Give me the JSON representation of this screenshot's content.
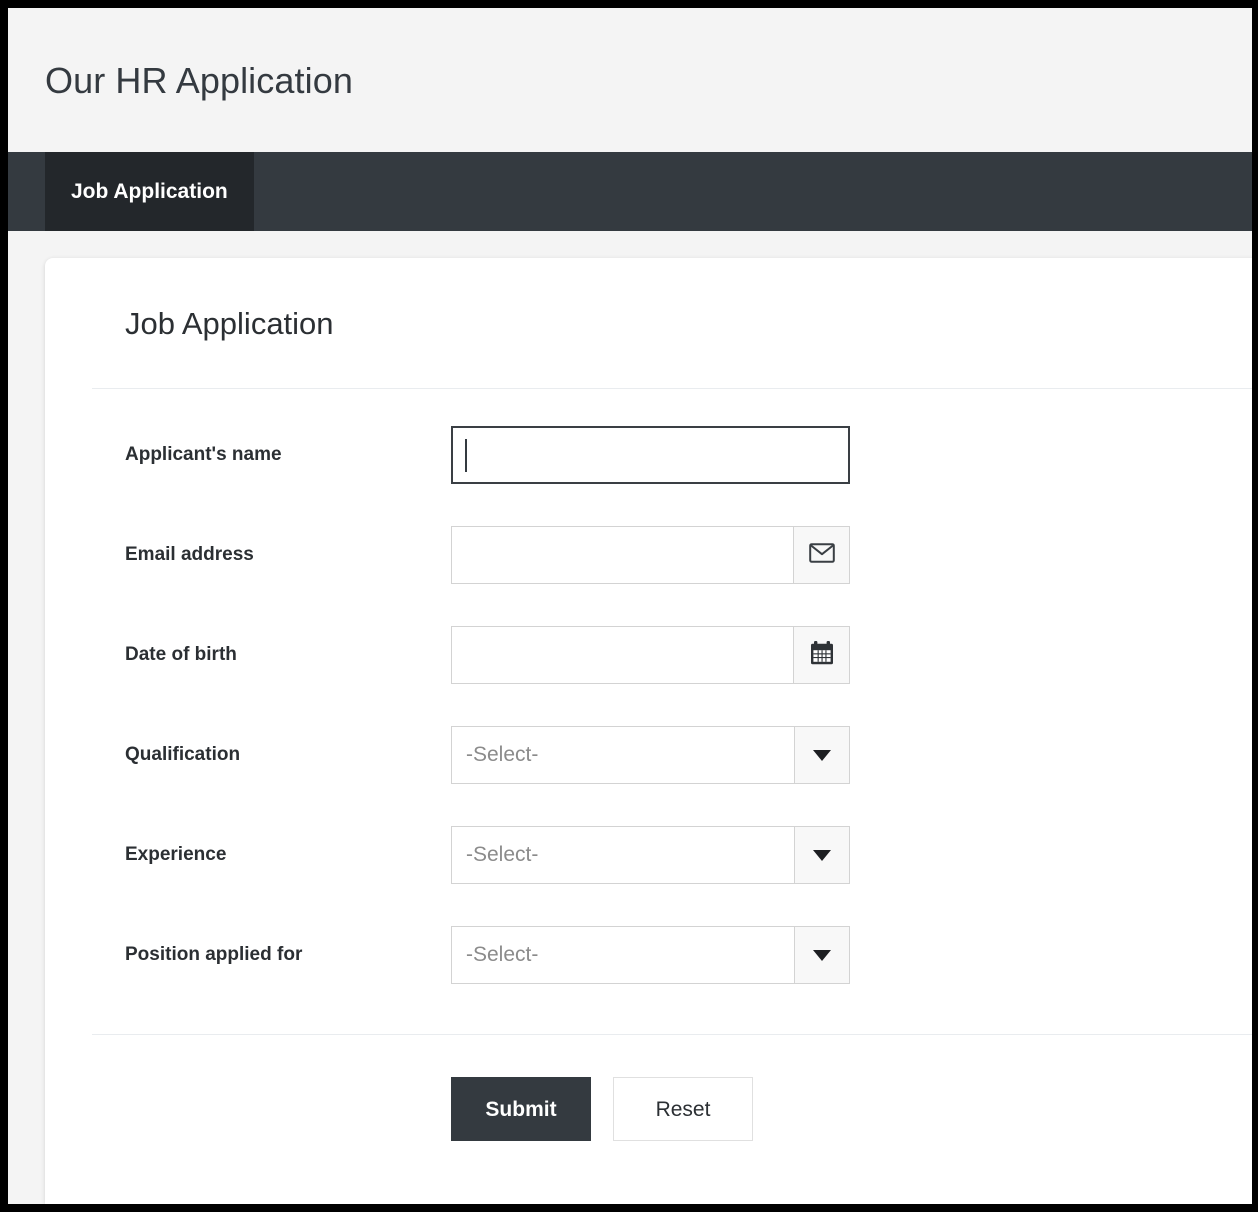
{
  "header": {
    "app_title": "Our HR Application"
  },
  "navbar": {
    "tabs": [
      {
        "label": "Job Application",
        "active": true
      }
    ]
  },
  "card": {
    "title": "Job Application",
    "fields": [
      {
        "label": "Applicant's name",
        "type": "text",
        "value": "",
        "placeholder": "",
        "focused": true,
        "addon_icon": ""
      },
      {
        "label": "Email address",
        "type": "text",
        "value": "",
        "placeholder": "",
        "focused": false,
        "addon_icon": "envelope-icon"
      },
      {
        "label": "Date of birth",
        "type": "text",
        "value": "",
        "placeholder": "",
        "focused": false,
        "addon_icon": "calendar-icon"
      },
      {
        "label": "Qualification",
        "type": "select",
        "value": "-Select-",
        "addon_icon": "chevron-down-icon"
      },
      {
        "label": "Experience",
        "type": "select",
        "value": "-Select-",
        "addon_icon": "chevron-down-icon"
      },
      {
        "label": "Position applied for",
        "type": "select",
        "value": "-Select-",
        "addon_icon": "chevron-down-icon"
      }
    ],
    "buttons": {
      "submit_label": "Submit",
      "reset_label": "Reset"
    }
  },
  "colors": {
    "navbar_bg": "#343a40",
    "active_tab_bg": "#23272b",
    "page_bg": "#f4f4f4",
    "card_bg": "#ffffff",
    "text_dark": "#2b2f33",
    "placeholder": "#8b8b8b",
    "border": "#d3d3d3",
    "primary_button": "#343a40"
  }
}
